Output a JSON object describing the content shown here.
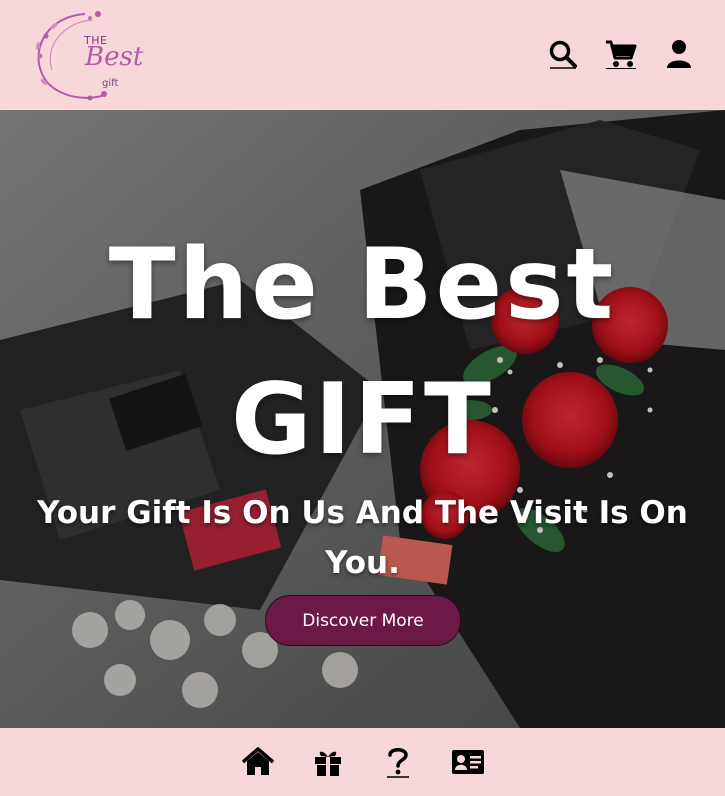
{
  "brand": {
    "logo_the": "THE",
    "logo_best": "Best",
    "logo_gift": "gift"
  },
  "header": {
    "icons": [
      "search-icon",
      "cart-icon",
      "user-icon"
    ]
  },
  "hero": {
    "title_line1": "The Best",
    "title_line2": "GIFT",
    "subtitle": "Your Gift Is On Us And The Visit Is On You.",
    "cta_label": "Discover More"
  },
  "bottom_nav": {
    "icons": [
      "home-icon",
      "gift-icon",
      "question-icon",
      "contact-card-icon"
    ]
  },
  "colors": {
    "page_bg": "#f8d7da",
    "cta_bg": "#6d1946",
    "logo_accent": "#b25ba8"
  }
}
